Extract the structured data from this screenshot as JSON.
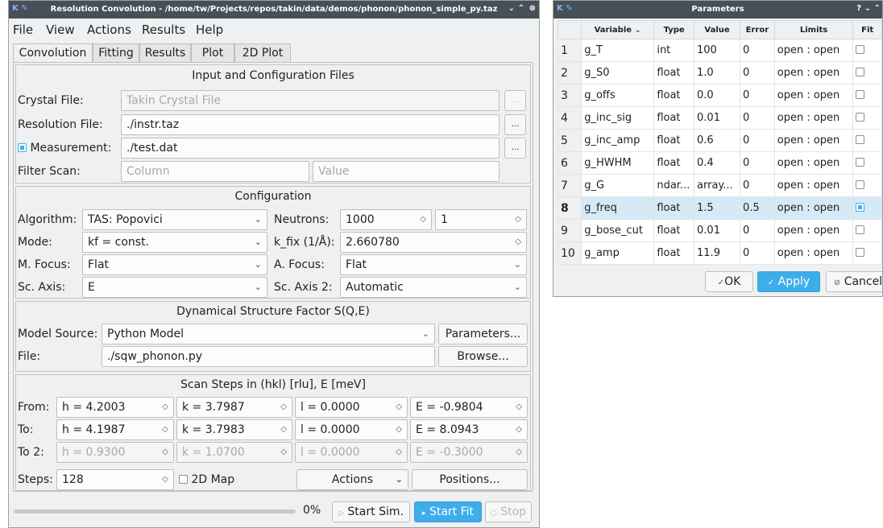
{
  "main_window": {
    "title": "Resolution Convolution - /home/tw/Projects/repos/takin/data/demos/phonon/phonon_simple_py.taz",
    "menu": [
      "File",
      "View",
      "Actions",
      "Results",
      "Help"
    ],
    "tabs": [
      "Convolution",
      "Fitting",
      "Results",
      "Plot",
      "2D Plot"
    ],
    "files": {
      "title": "Input and Configuration Files",
      "crystal_label": "Crystal File:",
      "crystal_value": "Takin Crystal File",
      "resolution_label": "Resolution File:",
      "resolution_value": "./instr.taz",
      "measurement_label": "Measurement:",
      "measurement_value": "./test.dat",
      "filter_label": "Filter Scan:",
      "filter_column": "Column",
      "filter_value": "Value",
      "browse_dots": "..."
    },
    "config": {
      "title": "Configuration",
      "algorithm_label": "Algorithm:",
      "algorithm_value": "TAS: Popovici",
      "neutrons_label": "Neutrons:",
      "neutrons_value": "1000",
      "neutrons_value2": "1",
      "mode_label": "Mode:",
      "mode_value": "kf = const.",
      "kfix_label": "k_fix (1/Å):",
      "kfix_value": "2.660780",
      "mfocus_label": "M. Focus:",
      "mfocus_value": "Flat",
      "afocus_label": "A. Focus:",
      "afocus_value": "Flat",
      "scaxis_label": "Sc. Axis:",
      "scaxis_value": "E",
      "scaxis2_label": "Sc. Axis 2:",
      "scaxis2_value": "Automatic"
    },
    "sqe": {
      "title": "Dynamical Structure Factor S(Q,E)",
      "model_label": "Model Source:",
      "model_value": "Python Model",
      "parameters_btn": "Parameters...",
      "file_label": "File:",
      "file_value": "./sqw_phonon.py",
      "browse_btn": "Browse..."
    },
    "scan": {
      "title": "Scan Steps in (hkl) [rlu], E [meV]",
      "from_label": "From:",
      "from": [
        "h = 4.2003",
        "k = 3.7987",
        "l = 0.0000",
        "E = -0.9804"
      ],
      "to_label": "To:",
      "to": [
        "h = 4.1987",
        "k = 3.7983",
        "l = 0.0000",
        "E = 8.0943"
      ],
      "to2_label": "To 2:",
      "to2": [
        "h = 0.9300",
        "k = 1.0700",
        "l = 0.0000",
        "E = -0.3000"
      ],
      "steps_label": "Steps:",
      "steps_value": "128",
      "map2d_label": "2D Map",
      "actions_btn": "Actions",
      "positions_btn": "Positions..."
    },
    "bottom": {
      "progress": 0,
      "progress_text": "0%",
      "start_sim": "Start Sim.",
      "start_fit": "Start Fit",
      "stop": "Stop"
    }
  },
  "param_window": {
    "title": "Parameters",
    "columns": [
      "Variable",
      "Type",
      "Value",
      "Error",
      "Limits",
      "Fit"
    ],
    "rows": [
      {
        "n": "1",
        "var": "g_T",
        "type": "int",
        "value": "100",
        "error": "0",
        "limits": "open : open",
        "fit": false
      },
      {
        "n": "2",
        "var": "g_S0",
        "type": "float",
        "value": "1.0",
        "error": "0",
        "limits": "open : open",
        "fit": false
      },
      {
        "n": "3",
        "var": "g_offs",
        "type": "float",
        "value": "0.0",
        "error": "0",
        "limits": "open : open",
        "fit": false
      },
      {
        "n": "4",
        "var": "g_inc_sig",
        "type": "float",
        "value": "0.01",
        "error": "0",
        "limits": "open : open",
        "fit": false
      },
      {
        "n": "5",
        "var": "g_inc_amp",
        "type": "float",
        "value": "0.6",
        "error": "0",
        "limits": "open : open",
        "fit": false
      },
      {
        "n": "6",
        "var": "g_HWHM",
        "type": "float",
        "value": "0.4",
        "error": "0",
        "limits": "open : open",
        "fit": false
      },
      {
        "n": "7",
        "var": "g_G",
        "type": "ndar...",
        "value": "array...",
        "error": "0",
        "limits": "open : open",
        "fit": false
      },
      {
        "n": "8",
        "var": "g_freq",
        "type": "float",
        "value": "1.5",
        "error": "0.5",
        "limits": "open : open",
        "fit": true
      },
      {
        "n": "9",
        "var": "g_bose_cut",
        "type": "float",
        "value": "0.01",
        "error": "0",
        "limits": "open : open",
        "fit": false
      },
      {
        "n": "10",
        "var": "g_amp",
        "type": "float",
        "value": "11.9",
        "error": "0",
        "limits": "open : open",
        "fit": false
      }
    ],
    "selected_row": 8,
    "ok_btn": "OK",
    "apply_btn": "Apply",
    "cancel_btn": "Cancel"
  }
}
